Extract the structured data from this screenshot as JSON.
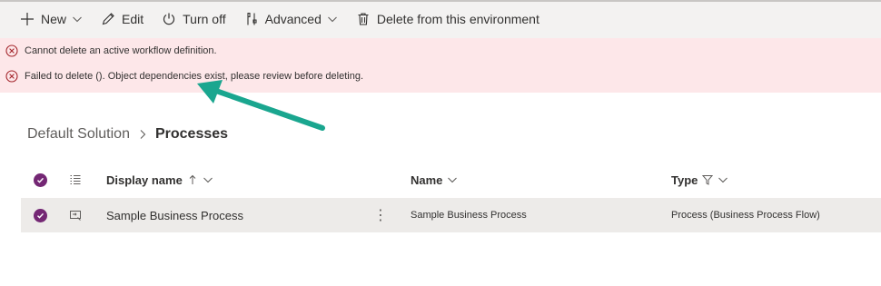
{
  "command_bar": {
    "new_label": "New",
    "edit_label": "Edit",
    "turn_off_label": "Turn off",
    "advanced_label": "Advanced",
    "delete_label": "Delete from this environment"
  },
  "errors": [
    {
      "message": "Cannot delete an active workflow definition."
    },
    {
      "message": "Failed to delete (). Object dependencies exist, please review before deleting."
    }
  ],
  "breadcrumb": {
    "root": "Default Solution",
    "current": "Processes"
  },
  "table": {
    "headers": {
      "display_name": "Display name",
      "name": "Name",
      "type": "Type"
    },
    "rows": [
      {
        "display_name": "Sample Business Process",
        "name": "Sample Business Process",
        "type": "Process (Business Process Flow)",
        "more": "⋮"
      }
    ]
  },
  "colors": {
    "command_bar_bg": "#f3f2f1",
    "error_bg": "#fde7e9",
    "error_icon": "#a4262c",
    "check_accent": "#742774",
    "arrow": "#1aa68f",
    "selected_row_bg": "#edebe9"
  }
}
